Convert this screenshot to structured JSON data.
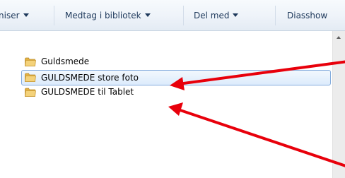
{
  "toolbar": {
    "organize_label": "niser",
    "library_label": "Medtag i bibliotek",
    "share_label": "Del med",
    "slideshow_label": "Diasshow"
  },
  "files": [
    {
      "name": "Guldsmede",
      "selected": false
    },
    {
      "name": "GULDSMEDE store foto",
      "selected": true
    },
    {
      "name": "GULDSMEDE til Tablet",
      "selected": false
    }
  ],
  "annotation": {
    "arrow_color": "#e8000b",
    "count": 2
  },
  "colors": {
    "toolbar_text": "#1e395b",
    "selection_border": "#84acdd",
    "folder": "#e9c157"
  }
}
